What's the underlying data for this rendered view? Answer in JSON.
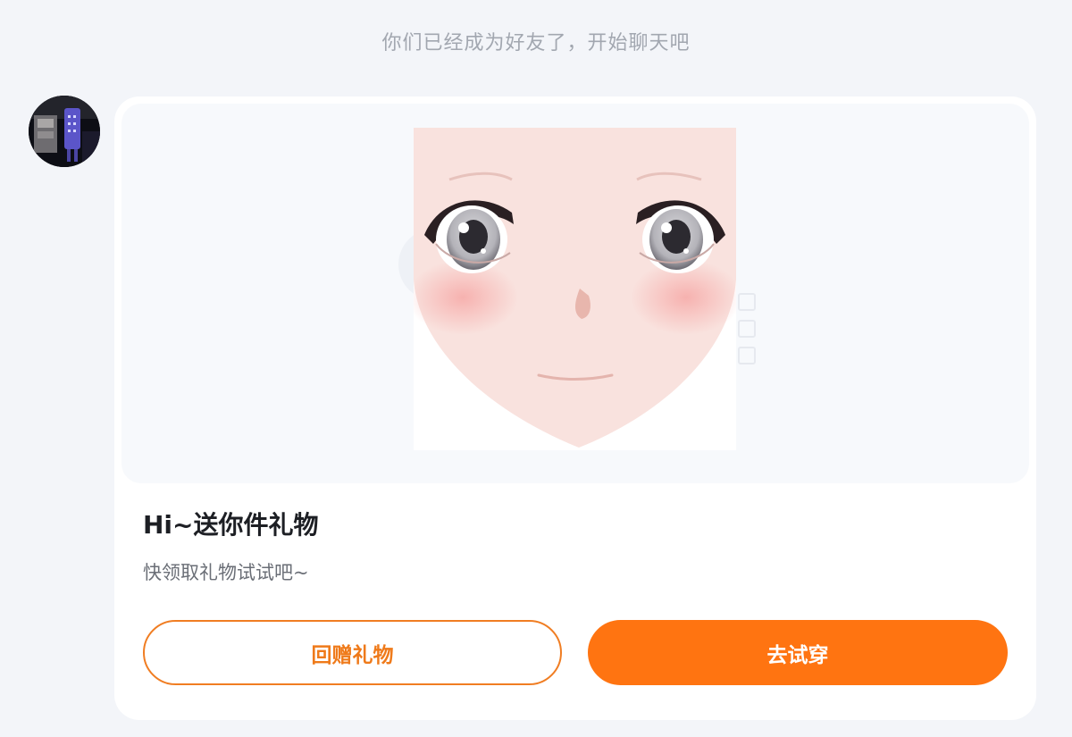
{
  "system_notice": "你们已经成为好友了，开始聊天吧",
  "message": {
    "avatar_icon": "user-avatar-icon",
    "preview_icon": "anime-face-sticker-icon",
    "title": "Hi~送你件礼物",
    "subtitle": "快领取礼物试试吧~",
    "buttons": {
      "return_gift_label": "回赠礼物",
      "try_on_label": "去试穿"
    }
  },
  "colors": {
    "page_background": "#f3f5f9",
    "accent_orange": "#ff7411",
    "card_background": "#ffffff",
    "notice_text": "#a2a7b0"
  }
}
